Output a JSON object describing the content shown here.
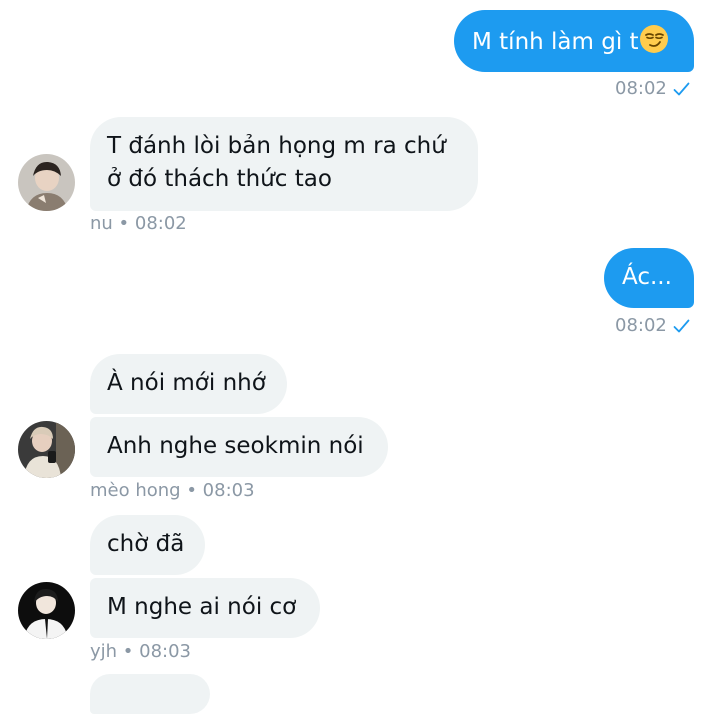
{
  "messages": [
    {
      "text": "M tính làm gì t",
      "emoji": "smirking-face",
      "time": "08:02"
    },
    {
      "lines": [
        "T đánh lòi bản họng m ra chứ",
        "ở đó thách thức tao"
      ],
      "meta": "nu • 08:02"
    },
    {
      "text": "Ác...",
      "time": "08:02"
    },
    {
      "text": "À nói mới nhớ"
    },
    {
      "text": "Anh nghe seokmin nói",
      "meta": "mèo hong • 08:03"
    },
    {
      "text": "chờ đã"
    },
    {
      "text": "M nghe ai nói cơ",
      "meta": "yjh • 08:03"
    }
  ],
  "icons": {
    "read_receipt": "check-icon",
    "emoji": "smirking-face-emoji"
  },
  "colors": {
    "outgoing_bubble": "#1d9bf0",
    "incoming_bubble": "#eff3f4",
    "meta_text": "#8b98a5",
    "check": "#1d9bf0"
  }
}
